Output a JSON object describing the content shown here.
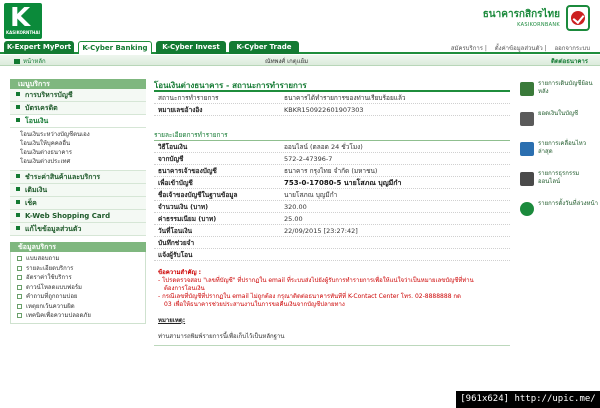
{
  "header": {
    "logo_letter": "K",
    "logo_text": "KASIKORNTHAI",
    "bank_name_th": "ธนาคารกสิกรไทย",
    "bank_name_en": "KASIKORNBANK"
  },
  "tabs": [
    {
      "label": "K-Expert MyPort",
      "active": false
    },
    {
      "label": "K-Cyber Banking",
      "active": true
    },
    {
      "label": "K-Cyber Invest",
      "active": false
    },
    {
      "label": "K-Cyber Trade",
      "active": false
    }
  ],
  "top_links": [
    "สมัครบริการ",
    "ตั้งค่าข้อมูลส่วนตัว",
    "ออกจากระบบ"
  ],
  "subbar": {
    "home": "หน้าหลัก",
    "user": "ณัทพงศ์ เกตุแย้ม",
    "contact": "ติดต่อธนาคาร"
  },
  "sidebar": {
    "menu_title": "เมนูบริการ",
    "items_top": [
      "การบริหารบัญชี",
      "บัตรเครดิต"
    ],
    "open_item": "โอนเงิน",
    "sub_items": [
      "โอนเงินระหว่างบัญชีตนเอง",
      "โอนเงินให้บุคคลอื่น",
      "โอนเงินต่างธนาคาร",
      "โอนเงินต่างประเทศ"
    ],
    "items_bottom": [
      "ชำระค่าสินค้าและบริการ",
      "เติมเงิน",
      "เช็ค",
      "K-Web Shopping Card",
      "แก้ไขข้อมูลส่วนตัว"
    ],
    "info_title": "ข้อมูลบริการ",
    "info_items": [
      "แบบสอบถาม",
      "รายละเอียดบริการ",
      "อัตราค่าใช้บริการ",
      "ดาวน์โหลดแบบฟอร์ม",
      "คำถามที่ถูกถามบ่อย",
      "เหตุยกเว้นความผิด",
      "เทคนิคเพื่อความปลอดภัย"
    ]
  },
  "main": {
    "title": "โอนเงินต่างธนาคาร - สถานะการทำรายการ",
    "status_label": "สถานะการทำรายการ",
    "status_value": "ธนาคารได้ทำรายการของท่านเรียบร้อยแล้ว",
    "ref_label": "หมายเลขอ้างอิง",
    "ref_value": "KBKR150922601907303",
    "section": "รายละเอียดการทำรายการ",
    "rows": [
      {
        "label": "วิธีโอนเงิน",
        "value": "ออนไลน์ (ตลอด 24 ชั่วโมง)",
        "bold_label": true,
        "bold_value": false
      },
      {
        "label": "จากบัญชี",
        "value": "572-2-47396-7",
        "bold_label": true,
        "bold_value": false
      },
      {
        "label": "ธนาคารเจ้าของบัญชี",
        "value": "ธนาคาร กรุงไทย จำกัด (มหาชน)",
        "bold_label": true,
        "bold_value": false
      },
      {
        "label": "เพื่อเข้าบัญชี",
        "value": "753-0-17080-5 นายโสภณ บุญมีกำ",
        "bold_label": true,
        "bold_value": true
      },
      {
        "label": "ชื่อเจ้าของบัญชีในฐานข้อมูล",
        "value": "นายโสภณ บุญมีกำ",
        "bold_label": true,
        "bold_value": false
      },
      {
        "label": "จำนวนเงิน (บาท)",
        "value": "320.00",
        "bold_label": true,
        "bold_value": false
      },
      {
        "label": "ค่าธรรมเนียม (บาท)",
        "value": "25.00",
        "bold_label": true,
        "bold_value": false
      },
      {
        "label": "วันที่โอนเงิน",
        "value": "22/09/2015 [23:27:42]",
        "bold_label": true,
        "bold_value": false
      },
      {
        "label": "บันทึกช่วยจำ",
        "value": "",
        "bold_label": true,
        "bold_value": false
      },
      {
        "label": "แจ้งผู้รับโอน",
        "value": "",
        "bold_label": true,
        "bold_value": false
      }
    ],
    "notes_head": "ข้อความสำคัญ :",
    "notes": [
      "- โปรดตรวจสอบ \"เลขที่บัญชี\" ที่ปรากฏใน email ที่ระบบส่งไปยังผู้รับการทำรายการเพื่อให้แน่ใจว่าเป็นหมายเลขบัญชีที่ท่าน",
      "ต้องการโอนเงิน",
      "- กรณีเลขที่บัญชีที่ปรากฏใน email ไม่ถูกต้อง กรุณาติดต่อธนาคารทันทีที่ K-Contact Center โทร. 02-8888888 กด",
      "03 เพื่อให้ธนาคารช่วยประสานงานในการขอคืนเงินจากบัญชีปลายทาง"
    ],
    "notes2_head": "หมายเหตุ:",
    "notes2": "ท่านสามารถพิมพ์รายการนี้เพื่อเก็บไว้เป็นหลักฐาน"
  },
  "right_panel": [
    {
      "label": "รายการเดินบัญชีย้อนหลัง",
      "color": "#3a7a3a"
    },
    {
      "label": "ยอดเงินในบัญชี",
      "color": "#5a5a5a"
    },
    {
      "label": "รายการเคลื่อนไหวล่าสุด",
      "color": "#2b6fb0"
    },
    {
      "label": "รายการธุรกรรมออนไลน์",
      "color": "#4a4a4a"
    },
    {
      "label": "รายการตั้งวันที่ล่วงหน้า",
      "color": "#1b8a3c"
    }
  ],
  "watermark": "[961x624] http://upic.me/"
}
